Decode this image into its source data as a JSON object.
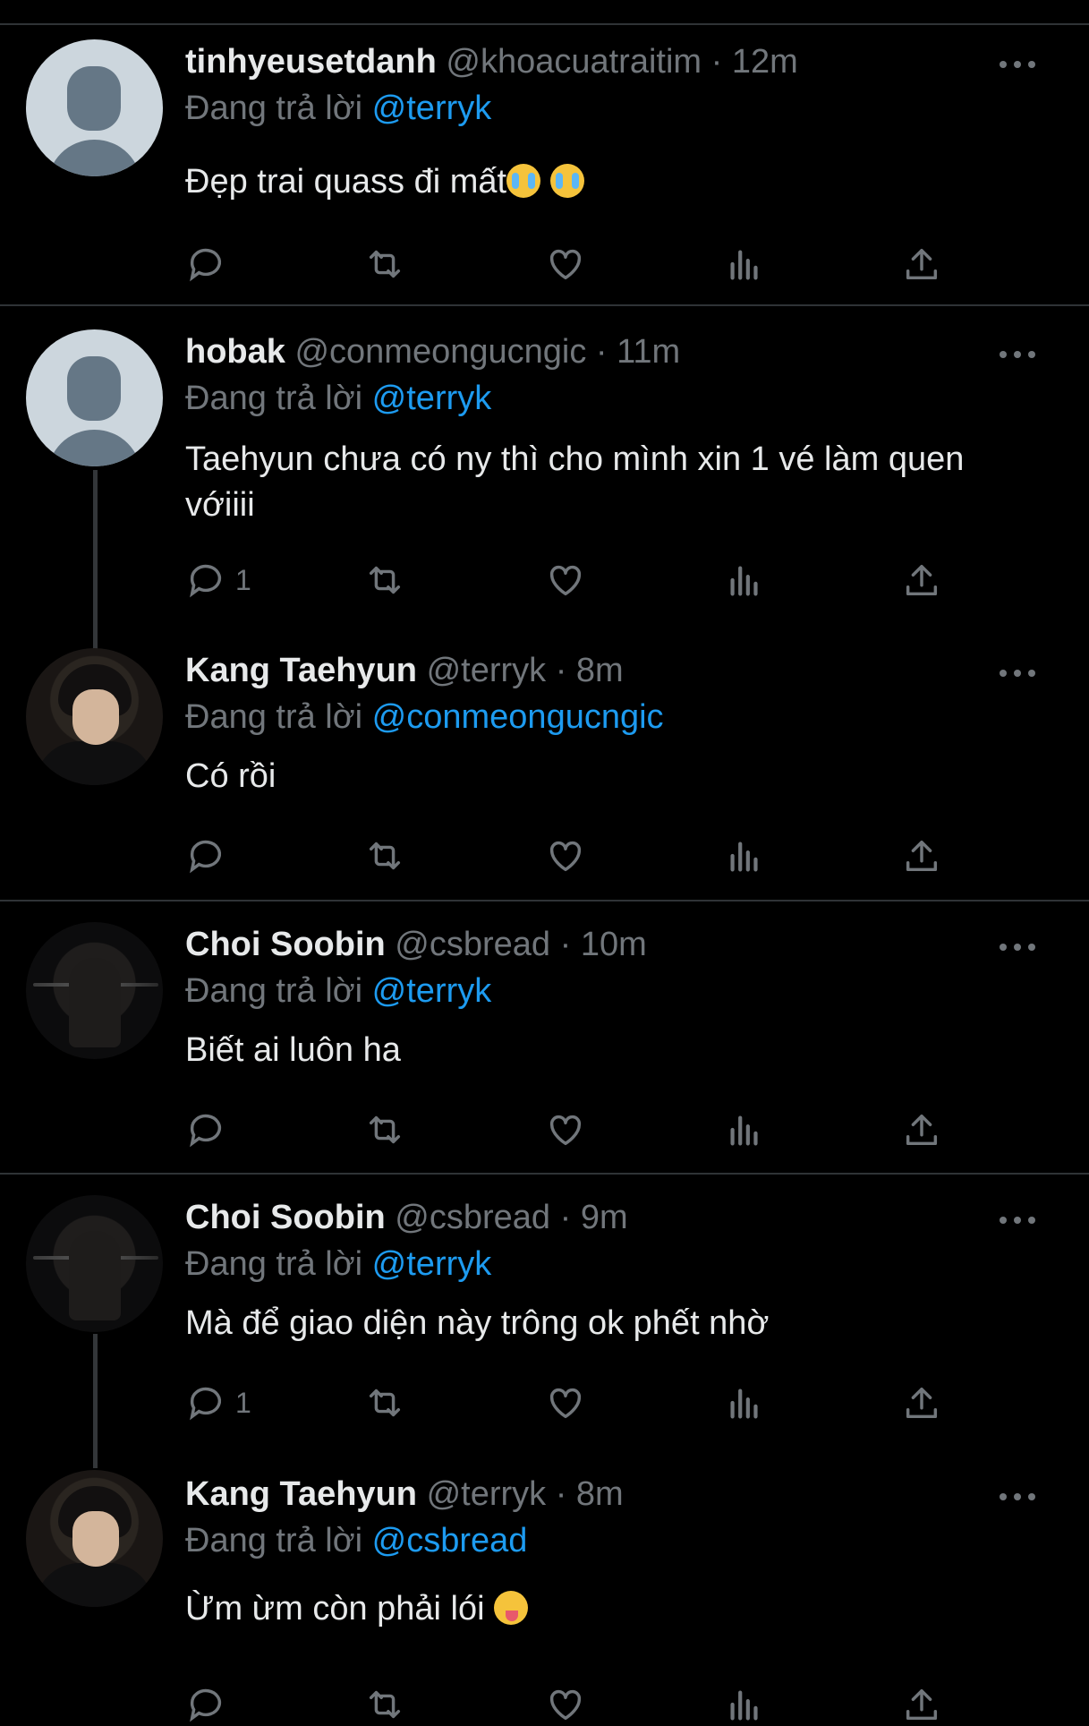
{
  "tweets": [
    {
      "name": "tinhyeusetdanh",
      "meta": "@khoacuatraitim · 12m",
      "reply_prefix": "Đang trả lời",
      "reply_to": "@terryk",
      "text": "Đẹp trai quass đi mất",
      "emoji": [
        "loudly-crying-face",
        "loudly-crying-face"
      ],
      "reply_count": "",
      "avatar": "default-avatar"
    },
    {
      "name": "hobak",
      "meta": "@conmeongucngic · 11m",
      "reply_prefix": "Đang trả lời",
      "reply_to": "@terryk",
      "text": "Taehyun chưa có ny thì cho mình xin 1 vé làm quen vớiiii",
      "reply_count": "1",
      "avatar": "default-avatar"
    },
    {
      "name": "Kang Taehyun",
      "meta": "@terryk · 8m",
      "reply_prefix": "Đang trả lời",
      "reply_to": "@conmeongucngic",
      "text": "Có rồi",
      "reply_count": "",
      "avatar": "taehyun-photo"
    },
    {
      "name": "Choi Soobin",
      "meta": "@csbread · 10m",
      "reply_prefix": "Đang trả lời",
      "reply_to": "@terryk",
      "text": "Biết ai luôn ha",
      "reply_count": "",
      "avatar": "soobin-photo"
    },
    {
      "name": "Choi Soobin",
      "meta": "@csbread · 9m",
      "reply_prefix": "Đang trả lời",
      "reply_to": "@terryk",
      "text": "Mà để giao diện này trông ok phết nhờ",
      "reply_count": "1",
      "avatar": "soobin-photo"
    },
    {
      "name": "Kang Taehyun",
      "meta": "@terryk · 8m",
      "reply_prefix": "Đang trả lời",
      "reply_to": "@csbread",
      "text": "Ừm ừm còn phải lói",
      "emoji": [
        "squinting-face-with-tongue"
      ],
      "reply_count": "",
      "avatar": "taehyun-photo"
    }
  ],
  "icons": {
    "reply": "reply-icon",
    "retweet": "retweet-icon",
    "like": "heart-icon",
    "views": "analytics-icon",
    "share": "share-icon",
    "more": "more-icon"
  },
  "colors": {
    "background": "#000000",
    "text": "#e7e9ea",
    "muted": "#71767b",
    "link": "#1d9bf0",
    "divider": "#2f3336"
  }
}
